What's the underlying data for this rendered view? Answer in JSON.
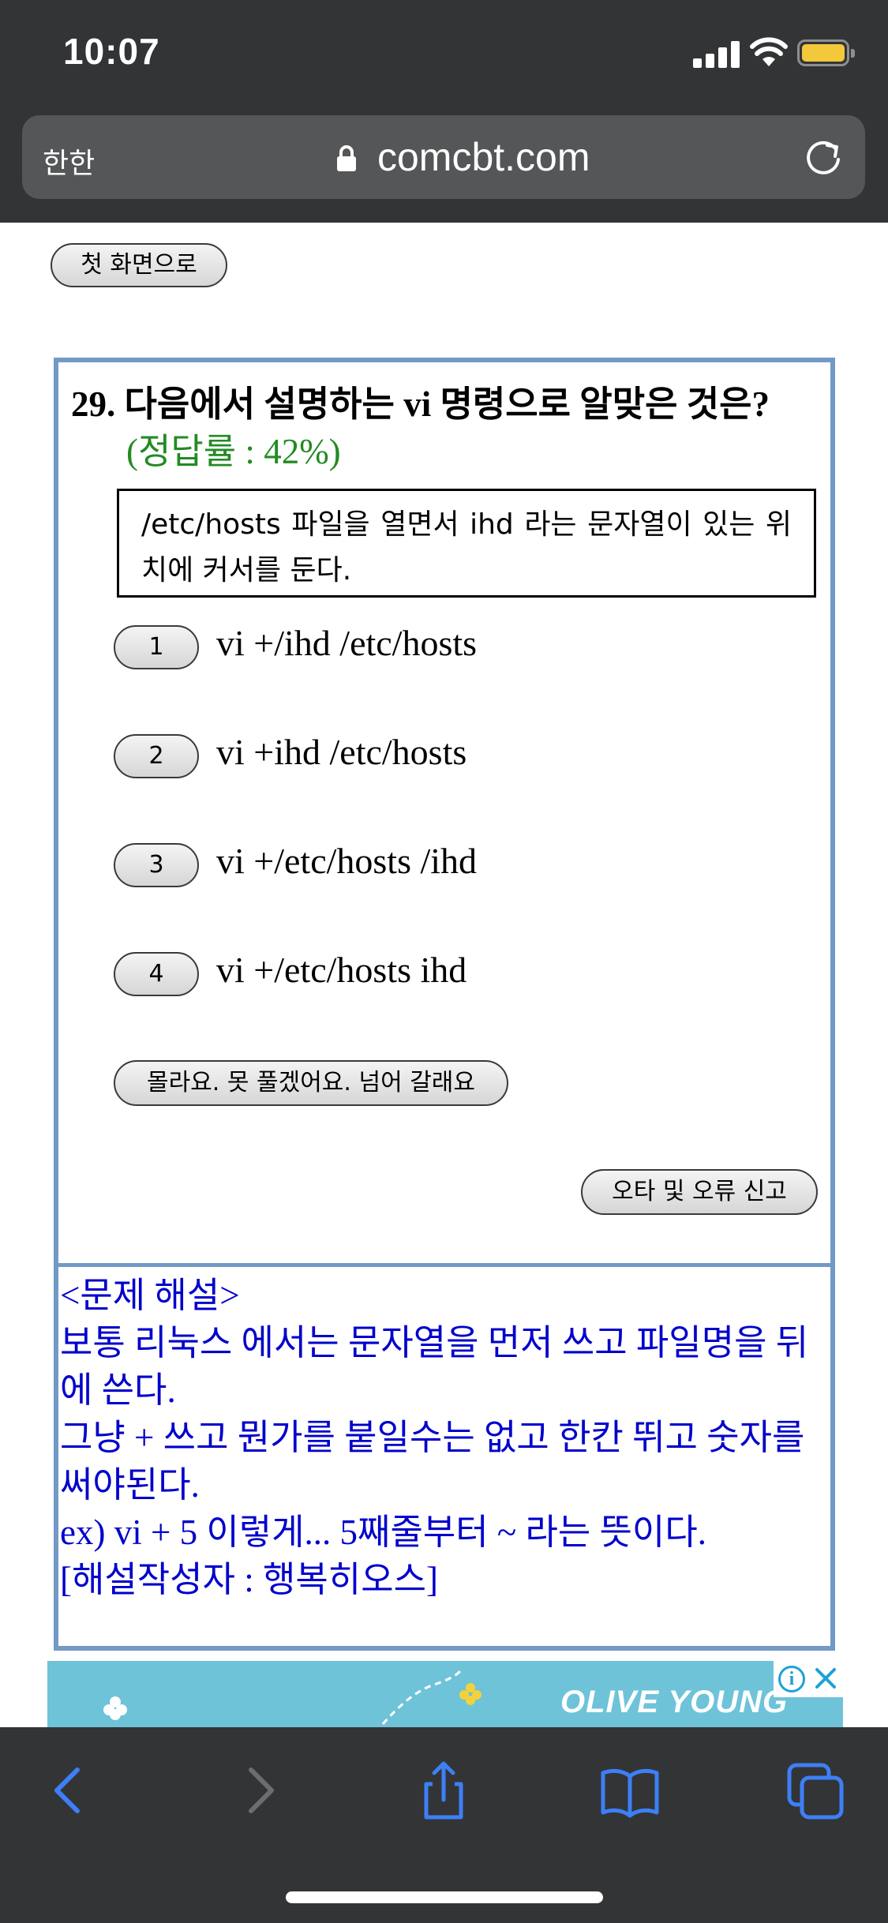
{
  "status_bar": {
    "time": "10:07"
  },
  "browser": {
    "text_size_label": "한한",
    "url": "comcbt.com"
  },
  "page": {
    "home_button": "첫 화면으로",
    "question": {
      "title": "29. 다음에서 설명하는 vi 명령으로 알맞은 것은?",
      "correct_rate": "(정답률 : 42%)",
      "passage": "/etc/hosts 파일을 열면서 ihd 라는 문자열이 있는 위치에 커서를 둔다.",
      "options": [
        {
          "number": "1",
          "text": "vi +/ihd /etc/hosts"
        },
        {
          "number": "2",
          "text": "vi +ihd /etc/hosts"
        },
        {
          "number": "3",
          "text": "vi +/etc/hosts /ihd"
        },
        {
          "number": "4",
          "text": "vi +/etc/hosts ihd"
        }
      ],
      "skip_button": "몰라요. 못 풀겠어요. 넘어 갈래요",
      "report_button": "오타 및 오류 신고"
    },
    "explanation": {
      "heading": "<문제 해설>",
      "line1": "보통 리눅스 에서는 문자열을 먼저 쓰고 파일명을 뒤에 쓴다.",
      "line2": "그냥 + 쓰고 뭔가를 붙일수는 없고 한칸 뛰고 숫자를 써야된다.",
      "line3": "ex) vi + 5 이렇게... 5째줄부터 ~ 라는 뜻이다.",
      "author": "[해설작성자 : 행복히오스]"
    }
  },
  "ad": {
    "brand": "OLIVE YOUNG",
    "info_label": "i"
  },
  "colors": {
    "accent_border": "#7399c6",
    "rate_green": "#228b22",
    "explanation_blue": "#0000cc",
    "ios_blue": "#3d7ff6"
  },
  "icons": [
    "signal-icon",
    "wifi-icon",
    "battery-icon",
    "lock-icon",
    "reload-icon",
    "back-icon",
    "forward-icon",
    "share-icon",
    "bookmarks-icon",
    "tabs-icon"
  ]
}
